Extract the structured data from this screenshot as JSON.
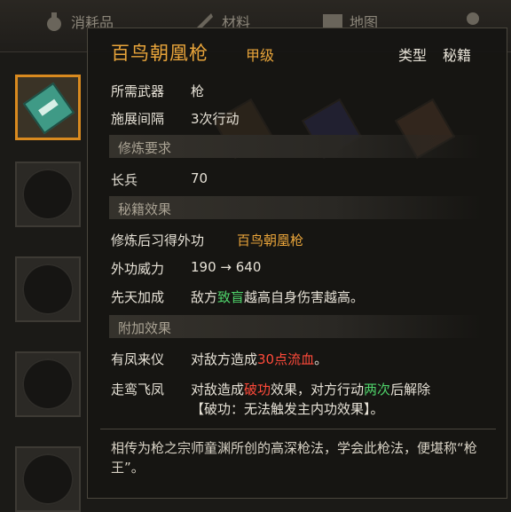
{
  "nav": {
    "tabs": [
      {
        "label": "消耗品",
        "icon": "potion-icon"
      },
      {
        "label": "材料",
        "icon": "materials-icon"
      },
      {
        "label": "地图",
        "icon": "map-icon"
      },
      {
        "label": "",
        "icon": "quest-icon"
      }
    ]
  },
  "item": {
    "name": "百鸟朝凰枪",
    "grade": "甲级",
    "type_label": "类型",
    "type_value": "秘籍",
    "weapon_label": "所需武器",
    "weapon_value": "枪",
    "interval_label": "施展间隔",
    "interval_value": "3次行动",
    "section_req": "修炼要求",
    "req_label": "长兵",
    "req_value": "70",
    "section_effect": "秘籍效果",
    "learn_label": "修炼后习得外功",
    "learn_value": "百鸟朝凰枪",
    "power_label": "外功威力",
    "power_value": "190 → 640",
    "innate_label": "先天加成",
    "innate_pre": "敌方",
    "innate_hl": "致盲",
    "innate_post": "越高自身伤害越高。",
    "section_extra": "附加效果",
    "e1_label": "有凤来仪",
    "e1_pre": "对敌方造成",
    "e1_hl": "30点流血",
    "e1_post": "。",
    "e2_label": "走鸾飞凤",
    "e2_pre": "对敌造成",
    "e2_hl1": "破功",
    "e2_mid": "效果，对方行动",
    "e2_hl2": "两次",
    "e2_post": "后解除",
    "e2_note": "【破功：无法触发主内功效果】。",
    "description": "相传为枪之宗师童渊所创的高深枪法，学会此枪法，便堪称“枪王”。"
  },
  "colors": {
    "accent": "#e8a43a",
    "green": "#4fd36a",
    "red": "#ff4a3a"
  }
}
